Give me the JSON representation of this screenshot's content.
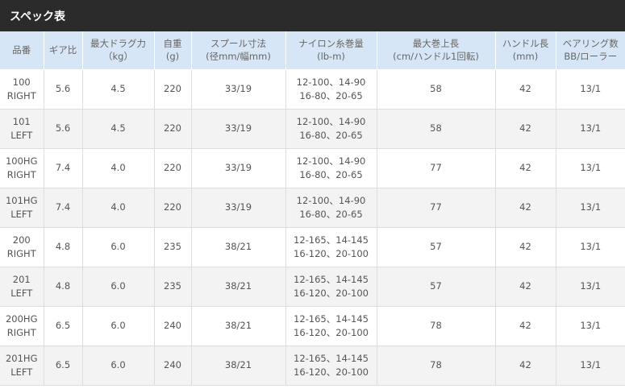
{
  "title": "スペック表",
  "columns": [
    {
      "lines": [
        "品番"
      ]
    },
    {
      "lines": [
        "ギア比"
      ]
    },
    {
      "lines": [
        "最大ドラグ力",
        "（kg）"
      ]
    },
    {
      "lines": [
        "自重",
        "(g)"
      ]
    },
    {
      "lines": [
        "スプール寸法",
        "(径mm/幅mm)"
      ]
    },
    {
      "lines": [
        "ナイロン糸巻量",
        "(lb-m)"
      ]
    },
    {
      "lines": [
        "最大巻上長",
        "(cm/ハンドル1回転)"
      ]
    },
    {
      "lines": [
        "ハンドル長",
        "(mm)"
      ]
    },
    {
      "lines": [
        "ベアリング数",
        "BB/ローラー"
      ]
    }
  ],
  "rows": [
    [
      [
        "100",
        "RIGHT"
      ],
      [
        "5.6"
      ],
      [
        "4.5"
      ],
      [
        "220"
      ],
      [
        "33/19"
      ],
      [
        "12-100、14-90",
        "16-80、20-65"
      ],
      [
        "58"
      ],
      [
        "42"
      ],
      [
        "13/1"
      ]
    ],
    [
      [
        "101",
        "LEFT"
      ],
      [
        "5.6"
      ],
      [
        "4.5"
      ],
      [
        "220"
      ],
      [
        "33/19"
      ],
      [
        "12-100、14-90",
        "16-80、20-65"
      ],
      [
        "58"
      ],
      [
        "42"
      ],
      [
        "13/1"
      ]
    ],
    [
      [
        "100HG",
        "RIGHT"
      ],
      [
        "7.4"
      ],
      [
        "4.0"
      ],
      [
        "220"
      ],
      [
        "33/19"
      ],
      [
        "12-100、14-90",
        "16-80、20-65"
      ],
      [
        "77"
      ],
      [
        "42"
      ],
      [
        "13/1"
      ]
    ],
    [
      [
        "101HG",
        "LEFT"
      ],
      [
        "7.4"
      ],
      [
        "4.0"
      ],
      [
        "220"
      ],
      [
        "33/19"
      ],
      [
        "12-100、14-90",
        "16-80、20-65"
      ],
      [
        "77"
      ],
      [
        "42"
      ],
      [
        "13/1"
      ]
    ],
    [
      [
        "200",
        "RIGHT"
      ],
      [
        "4.8"
      ],
      [
        "6.0"
      ],
      [
        "235"
      ],
      [
        "38/21"
      ],
      [
        "12-165、14-145",
        "16-120、20-100"
      ],
      [
        "57"
      ],
      [
        "42"
      ],
      [
        "13/1"
      ]
    ],
    [
      [
        "201",
        "LEFT"
      ],
      [
        "4.8"
      ],
      [
        "6.0"
      ],
      [
        "235"
      ],
      [
        "38/21"
      ],
      [
        "12-165、14-145",
        "16-120、20-100"
      ],
      [
        "57"
      ],
      [
        "42"
      ],
      [
        "13/1"
      ]
    ],
    [
      [
        "200HG",
        "RIGHT"
      ],
      [
        "6.5"
      ],
      [
        "6.0"
      ],
      [
        "240"
      ],
      [
        "38/21"
      ],
      [
        "12-165、14-145",
        "16-120、20-100"
      ],
      [
        "78"
      ],
      [
        "42"
      ],
      [
        "13/1"
      ]
    ],
    [
      [
        "201HG",
        "LEFT"
      ],
      [
        "6.5"
      ],
      [
        "6.0"
      ],
      [
        "240"
      ],
      [
        "38/21"
      ],
      [
        "12-165、14-145",
        "16-120、20-100"
      ],
      [
        "78"
      ],
      [
        "42"
      ],
      [
        "13/1"
      ]
    ]
  ],
  "colors": {
    "title_bg": "#2b2b2b",
    "header_bg": "#d7e6f6",
    "alt_row_bg": "#f3f3f3",
    "text": "#555555"
  }
}
